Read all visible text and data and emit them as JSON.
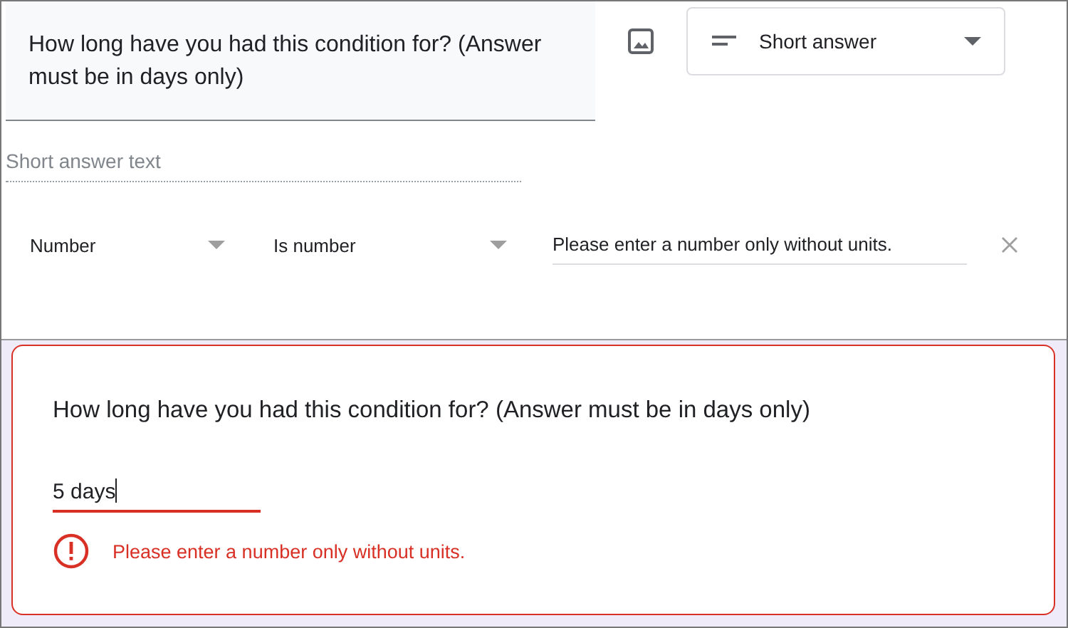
{
  "editor": {
    "question": "How long have you had this condition for? (Answer must be in days only)",
    "question_type": "Short answer",
    "answer_placeholder": "Short answer text",
    "validation": {
      "type": "Number",
      "condition": "Is number",
      "error_text": "Please enter a number only without units."
    }
  },
  "preview": {
    "question": "How long have you had this condition for? (Answer must be in days only)",
    "answer": "5 days",
    "invalid": true,
    "error_message": "Please enter a number only without units."
  }
}
